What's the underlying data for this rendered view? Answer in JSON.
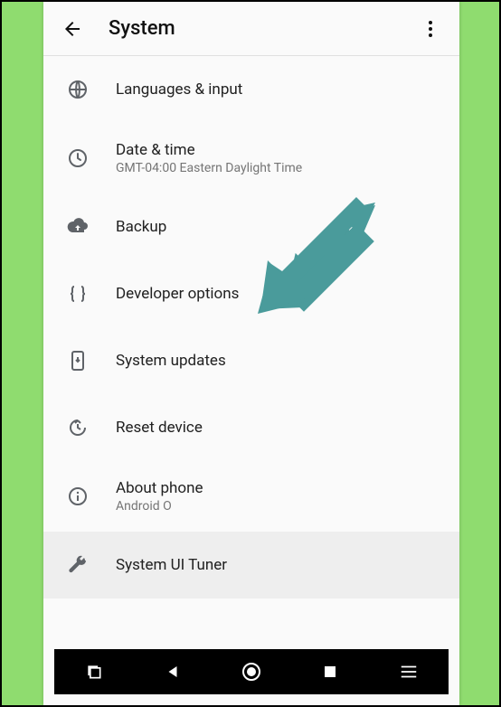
{
  "toolbar": {
    "title": "System"
  },
  "items": [
    {
      "label": "Languages & input",
      "sub": ""
    },
    {
      "label": "Date & time",
      "sub": "GMT-04:00 Eastern Daylight Time"
    },
    {
      "label": "Backup",
      "sub": ""
    },
    {
      "label": "Developer options",
      "sub": ""
    },
    {
      "label": "System updates",
      "sub": ""
    },
    {
      "label": "Reset device",
      "sub": ""
    },
    {
      "label": "About phone",
      "sub": "Android O"
    },
    {
      "label": "System UI Tuner",
      "sub": ""
    }
  ]
}
